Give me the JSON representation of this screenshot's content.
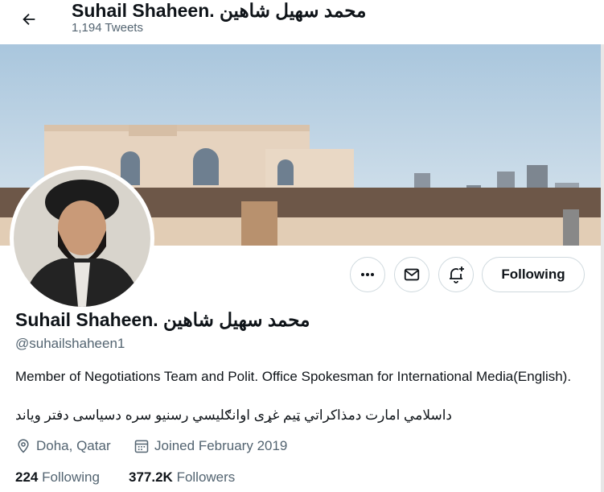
{
  "header": {
    "display_name": "Suhail Shaheen. محمد سهیل شاهین",
    "tweet_count": "1,194 Tweets"
  },
  "icons": {
    "back": "arrow-left-icon",
    "more": "more-horizontal-icon",
    "message": "envelope-icon",
    "notify": "bell-plus-icon",
    "location": "location-pin-icon",
    "calendar": "calendar-icon"
  },
  "actions": {
    "following_label": "Following"
  },
  "profile": {
    "display_name": "Suhail Shaheen. محمد سهیل شاهین",
    "handle": "@suhailshaheen1",
    "bio_line1": "Member of Negotiations Team and Polit. Office Spokesman for International Media(English).",
    "bio_line2": "داسلامي امارت دمذاکراتي ټيم غړی اوانګليسي رسنيو سره دسیاسی دفتر ویاند",
    "location": "Doha, Qatar",
    "joined": "Joined February 2019"
  },
  "stats": {
    "following_count": "224",
    "following_label": "Following",
    "followers_count": "377.2K",
    "followers_label": "Followers"
  },
  "colors": {
    "text_primary": "#0f1419",
    "text_secondary": "#536471",
    "border": "#cfd9de"
  }
}
